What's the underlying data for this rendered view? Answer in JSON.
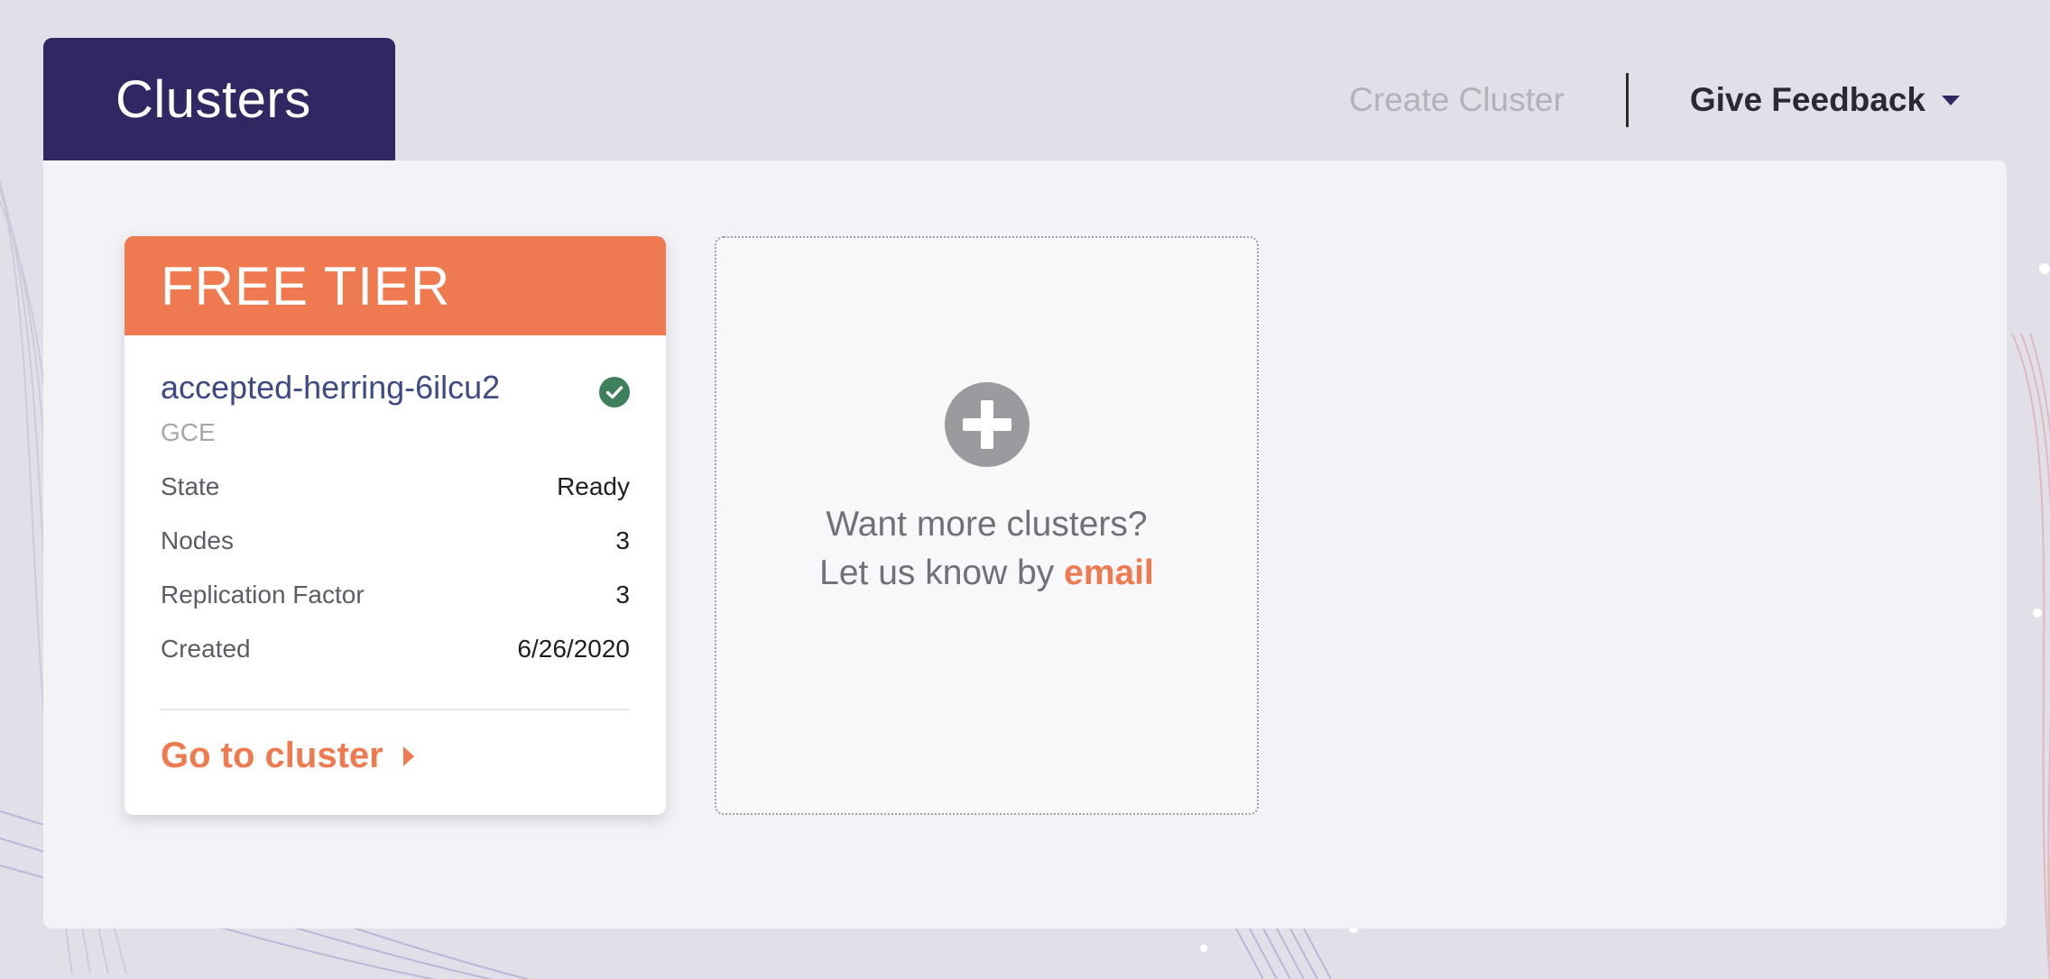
{
  "page": {
    "title": "Clusters"
  },
  "top_actions": {
    "create_cluster": "Create Cluster",
    "give_feedback": "Give Feedback"
  },
  "cluster_card": {
    "tier": "FREE TIER",
    "name": "accepted-herring-6ilcu2",
    "provider": "GCE",
    "status_icon": "check-circle-icon",
    "details": [
      {
        "label": "State",
        "value": "Ready"
      },
      {
        "label": "Nodes",
        "value": "3"
      },
      {
        "label": "Replication Factor",
        "value": "3"
      },
      {
        "label": "Created",
        "value": "6/26/2020"
      }
    ],
    "goto_label": "Go to cluster"
  },
  "add_card": {
    "icon": "plus-circle-icon",
    "line1": "Want more clusters?",
    "line2_prefix": "Let us know by ",
    "line2_link": "email"
  },
  "colors": {
    "brand_dark": "#302862",
    "accent": "#ef7a50",
    "success": "#3e7f5c",
    "background": "#e1e0e8"
  }
}
